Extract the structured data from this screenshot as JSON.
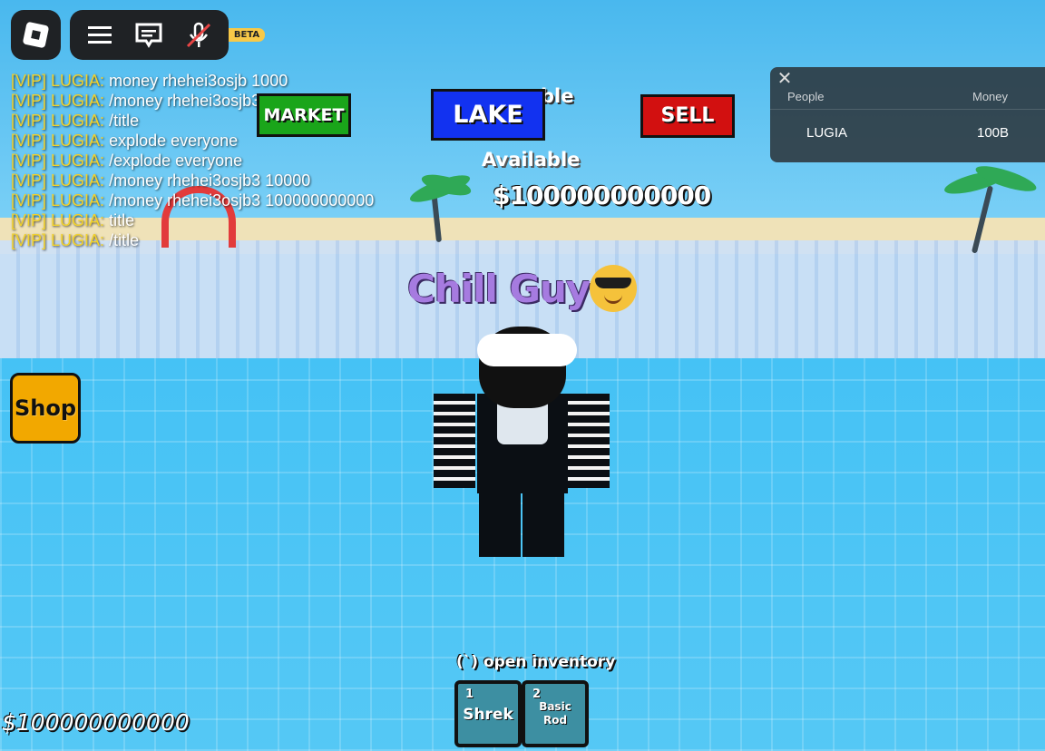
{
  "topbar": {
    "menu_icon": "hamburger-menu-icon",
    "chat_icon": "chat-icon",
    "mic_icon": "microphone-muted-icon",
    "beta_label": "BETA"
  },
  "chat": {
    "lines": [
      {
        "tag": "[VIP]",
        "name": "LUGIA:",
        "msg": "money rhehei3osjb 1000"
      },
      {
        "tag": "[VIP]",
        "name": "LUGIA:",
        "msg": "/money rhehei3osjb3 1000"
      },
      {
        "tag": "[VIP]",
        "name": "LUGIA:",
        "msg": "/title"
      },
      {
        "tag": "[VIP]",
        "name": "LUGIA:",
        "msg": "explode everyone"
      },
      {
        "tag": "[VIP]",
        "name": "LUGIA:",
        "msg": "/explode everyone"
      },
      {
        "tag": "[VIP]",
        "name": "LUGIA:",
        "msg": "/money rhehei3osjb3 10000"
      },
      {
        "tag": "[VIP]",
        "name": "LUGIA:",
        "msg": "/money rhehei3osjb3 100000000000"
      },
      {
        "tag": "[VIP]",
        "name": "LUGIA:",
        "msg": "title"
      },
      {
        "tag": "[VIP]",
        "name": "LUGIA:",
        "msg": "/title"
      }
    ]
  },
  "buttons": {
    "market": "MARKET",
    "lake": "LAKE",
    "sell": "SELL",
    "shop": "Shop"
  },
  "overhead": {
    "partial_title": "ble",
    "available": "Available",
    "money": "$100000000000"
  },
  "leaderboard": {
    "close_icon": "close-icon",
    "header_people": "People",
    "header_money": "Money",
    "rows": [
      {
        "name": "LUGIA",
        "money": "100B"
      }
    ]
  },
  "player": {
    "title": "Chill Guy",
    "emoji": "sunglasses-emoji-icon"
  },
  "inventory": {
    "hint": "(`) open inventory",
    "slots": [
      {
        "num": "1",
        "label": "Shrek"
      },
      {
        "num": "2",
        "label": "Basic Rod"
      }
    ]
  },
  "hud": {
    "money": "$100000000000"
  },
  "colors": {
    "market": "#1aa51a",
    "lake": "#1232f0",
    "sell": "#d21010",
    "shop": "#f2a800",
    "chat_vip": "#f3d22b",
    "title": "#a67be0"
  }
}
